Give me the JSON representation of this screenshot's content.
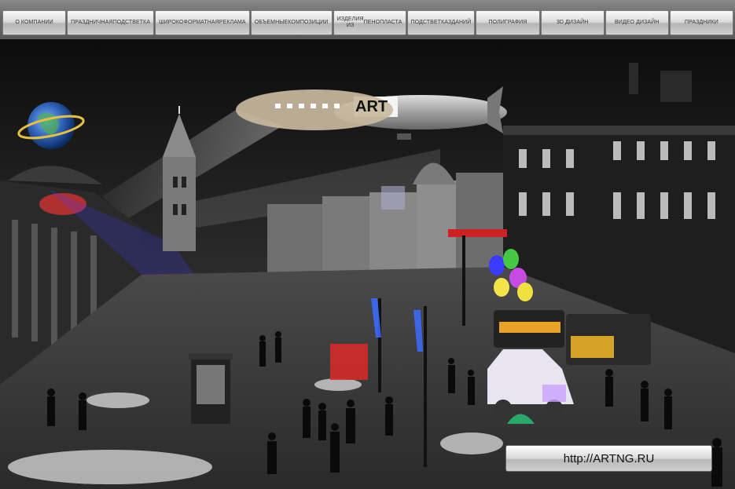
{
  "nav": {
    "items": [
      {
        "name": "nav-item-company",
        "lines": [
          "О КОМПАНИИ"
        ]
      },
      {
        "name": "nav-item-festive-decor",
        "lines": [
          "ПРАЗДНИЧНАЯ",
          "ПОДСТВЕТКА"
        ]
      },
      {
        "name": "nav-item-wide-format",
        "lines": [
          "ШИРОКОФОРМАТНАЯ",
          "РЕКЛАМА"
        ]
      },
      {
        "name": "nav-item-volume-compositions",
        "lines": [
          "ОБЪЕМНЫЕ",
          "КОМПОЗИЦИИ"
        ]
      },
      {
        "name": "nav-item-foam-products",
        "lines": [
          "ИЗДЕЛИЯ ИЗ",
          "ПЕНОПЛАСТА"
        ]
      },
      {
        "name": "nav-item-building-lighting",
        "lines": [
          "ПОДСТВЕТКА",
          "ЗДАНИЙ"
        ]
      },
      {
        "name": "nav-item-printing",
        "lines": [
          "ПОЛИГРАФИЯ"
        ]
      },
      {
        "name": "nav-item-3d-design",
        "lines": [
          "3D ДИЗАЙН"
        ]
      },
      {
        "name": "nav-item-video-design",
        "lines": [
          "ВИДЕО ДИЗАЙН"
        ]
      },
      {
        "name": "nav-item-holidays",
        "lines": [
          "ПРАЗДНИКИ"
        ]
      }
    ]
  },
  "scene": {
    "blimp_text": "ART",
    "banner_text": "",
    "url": "http://ARTNG.RU"
  }
}
